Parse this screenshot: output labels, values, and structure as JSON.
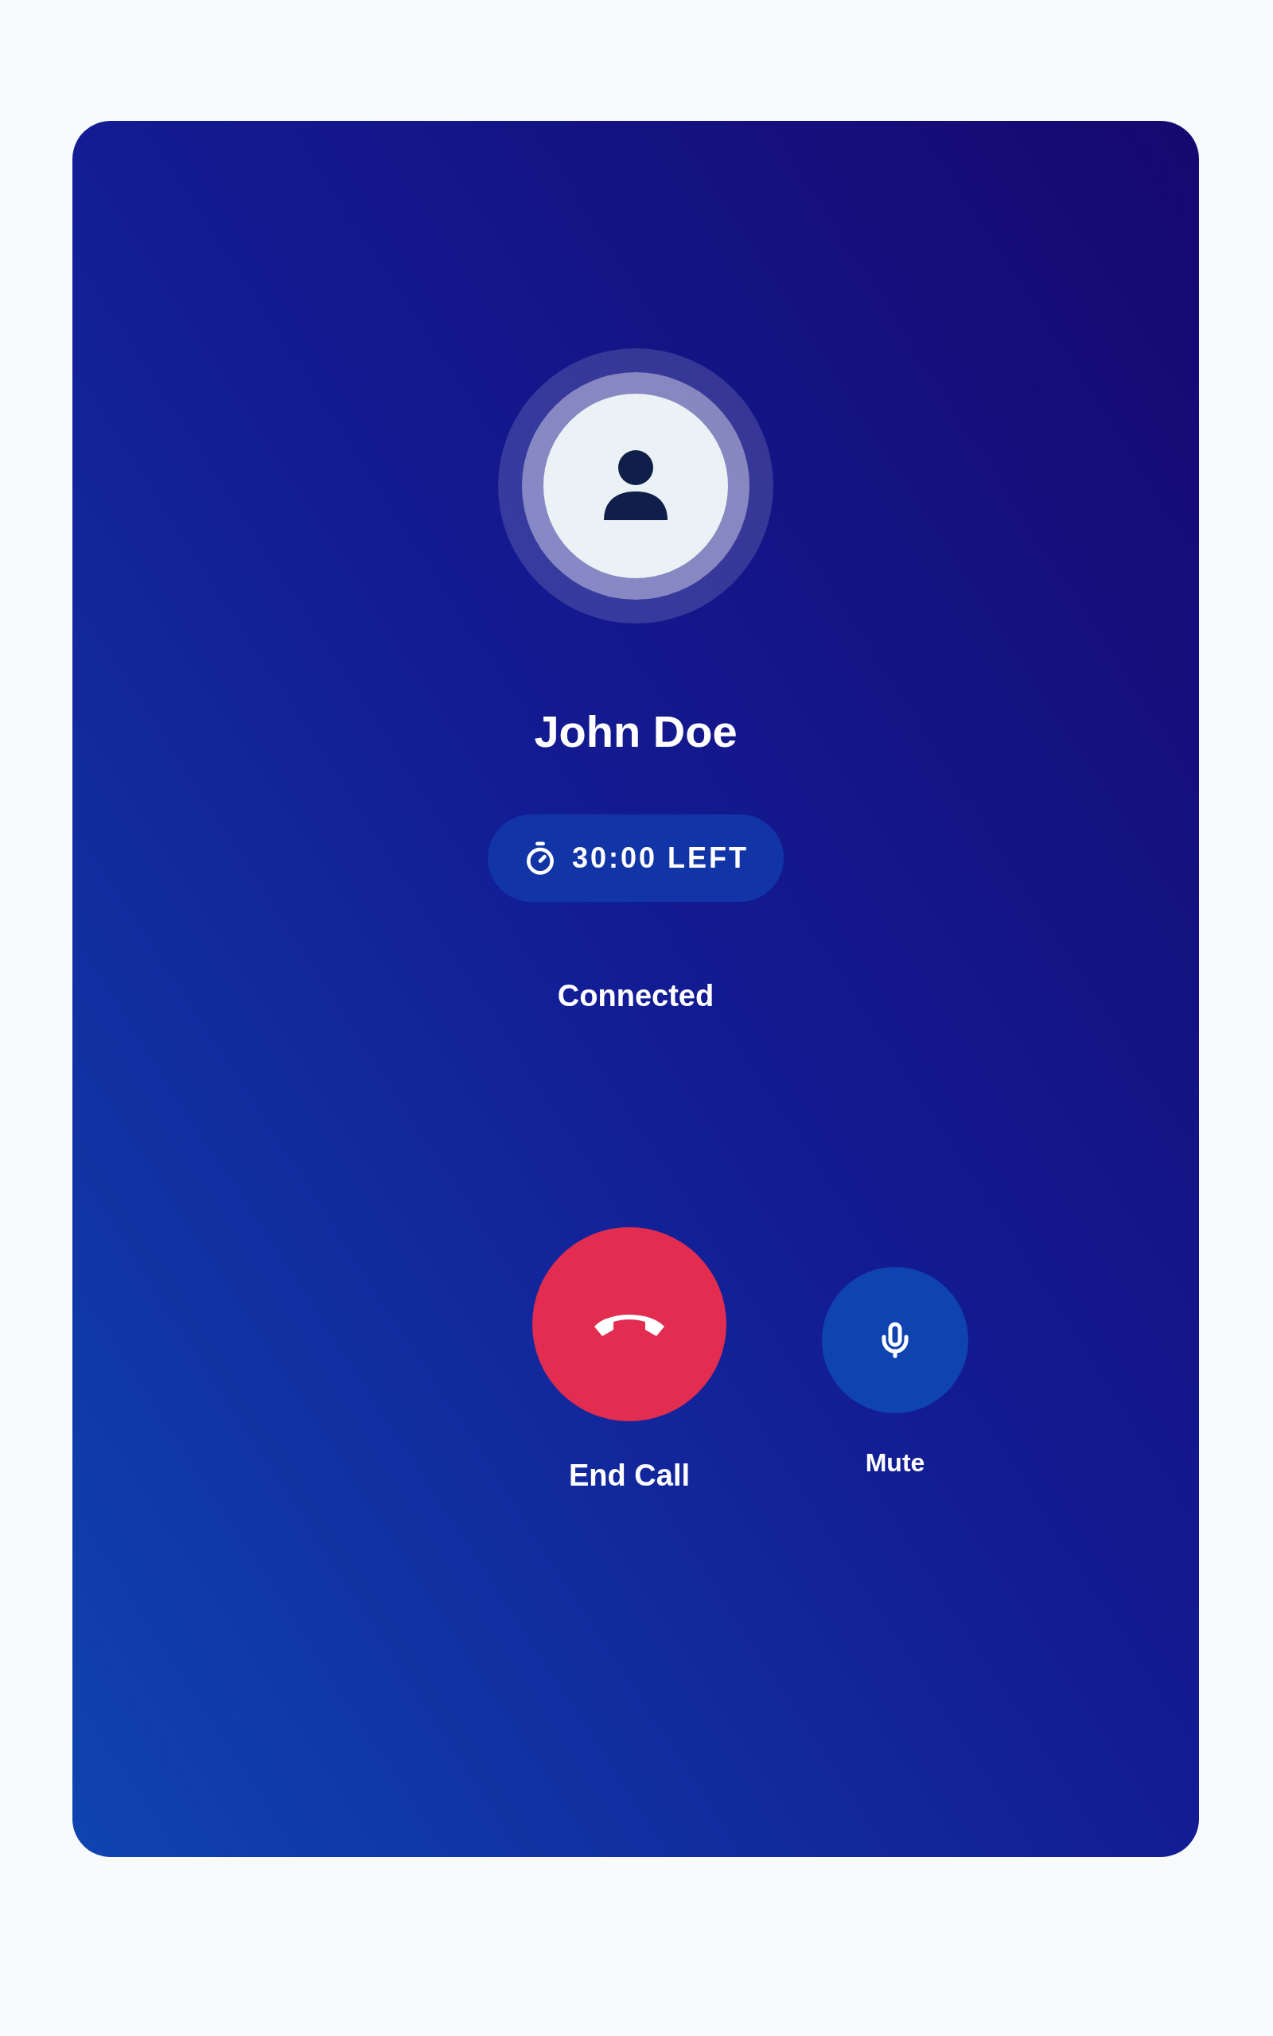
{
  "contact": {
    "name": "John Doe"
  },
  "timer": {
    "text": "30:00 LEFT"
  },
  "status": "Connected",
  "controls": [
    {
      "kind": "end",
      "label": "End Call"
    },
    {
      "kind": "mute",
      "label": "Mute",
      "muted": false
    }
  ]
}
